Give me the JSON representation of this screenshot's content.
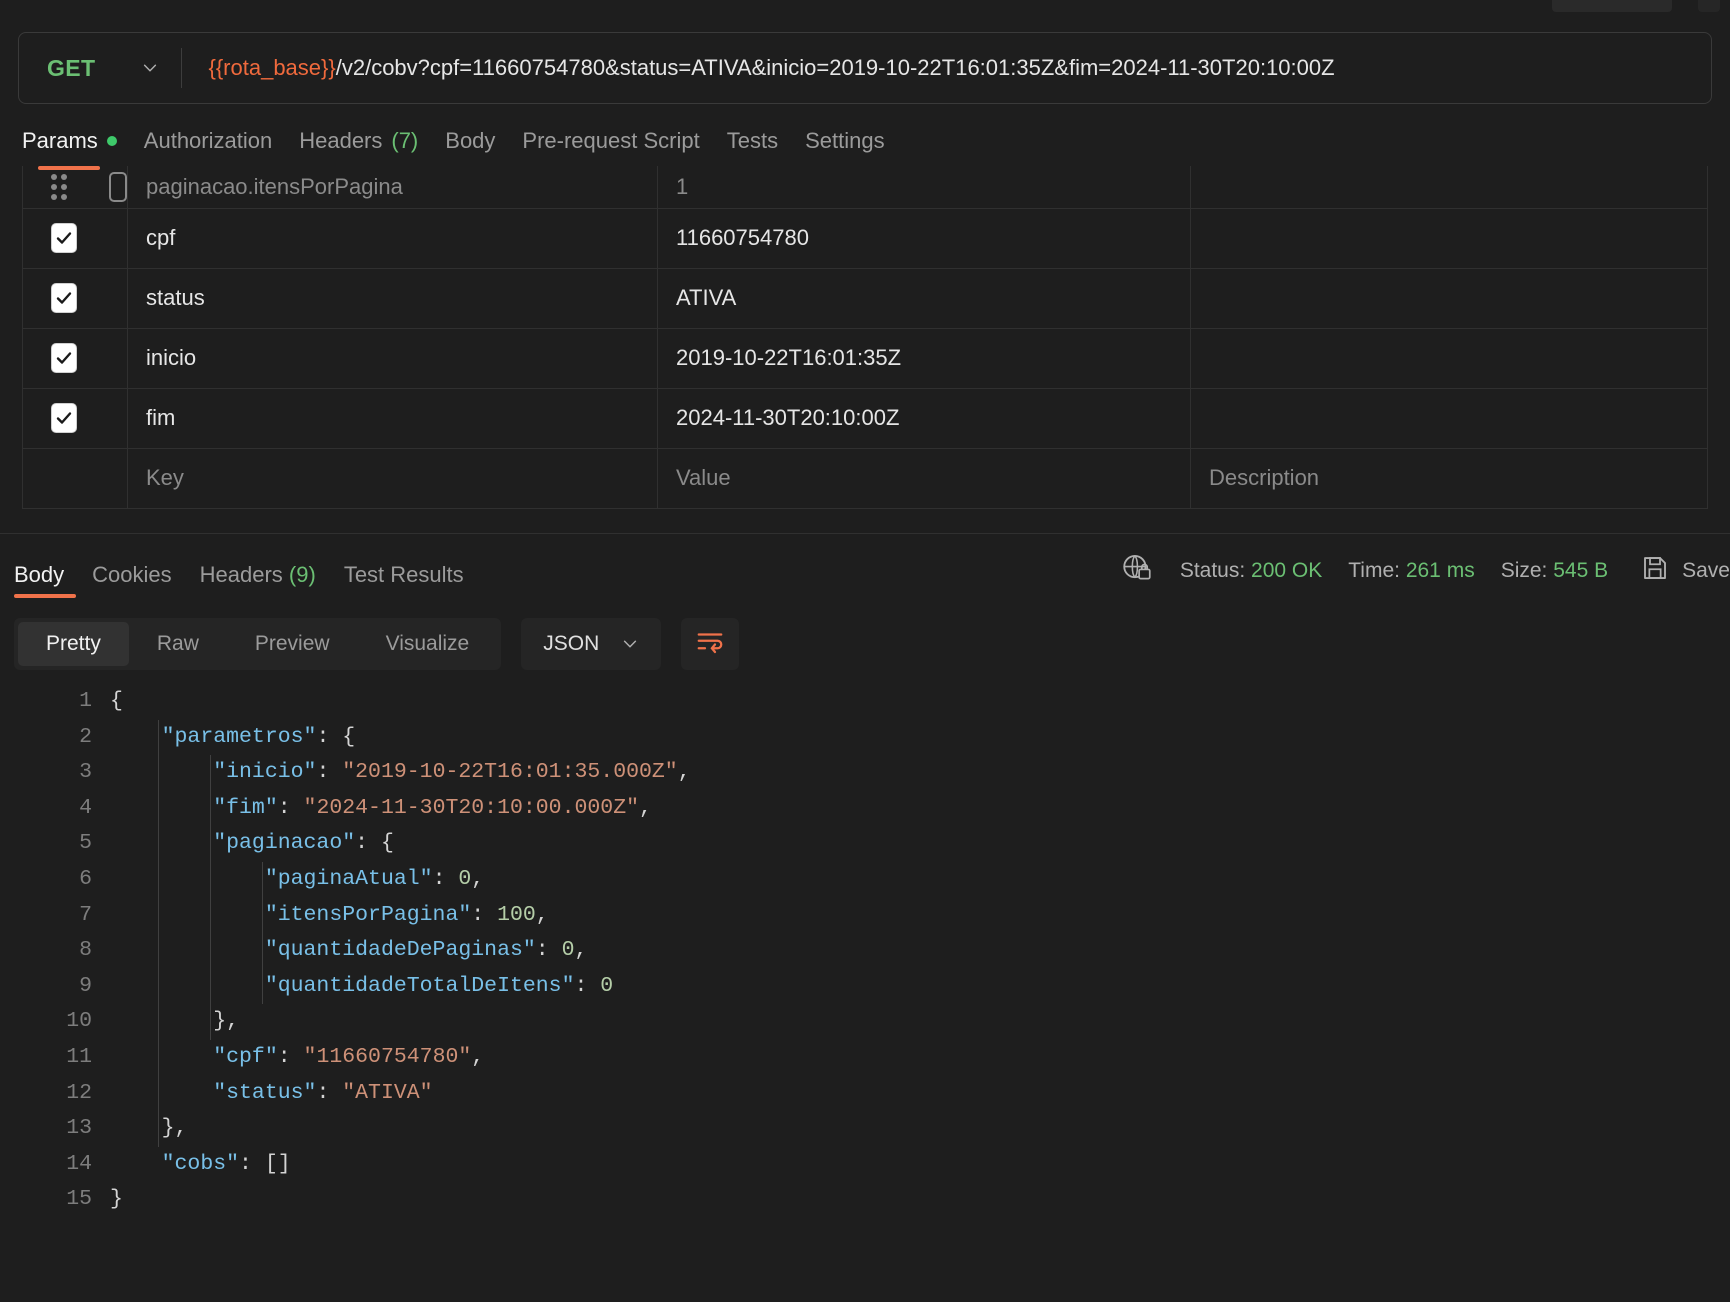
{
  "request": {
    "method": "GET",
    "url_prefix": "{{rota_base}}",
    "url_rest": "/v2/cobv?cpf=11660754780&status=ATIVA&inicio=2019-10-22T16:01:35Z&fim=2024-11-30T20:10:00Z",
    "tabs": [
      {
        "label": "Params",
        "badge": "",
        "dot": true,
        "active": true
      },
      {
        "label": "Authorization",
        "badge": "",
        "dot": false,
        "active": false
      },
      {
        "label": "Headers",
        "badge": "(7)",
        "dot": false,
        "active": false
      },
      {
        "label": "Body",
        "badge": "",
        "dot": false,
        "active": false
      },
      {
        "label": "Pre-request Script",
        "badge": "",
        "dot": false,
        "active": false
      },
      {
        "label": "Tests",
        "badge": "",
        "dot": false,
        "active": false
      },
      {
        "label": "Settings",
        "badge": "",
        "dot": false,
        "active": false
      }
    ]
  },
  "params_table": {
    "columns": [
      "Key",
      "Value",
      "Description"
    ],
    "rows": [
      {
        "checked": false,
        "key": "paginacao.itensPorPagina",
        "value": "1",
        "description": "",
        "ghost": true
      },
      {
        "checked": true,
        "key": "cpf",
        "value": "11660754780",
        "description": "",
        "ghost": false
      },
      {
        "checked": true,
        "key": "status",
        "value": "ATIVA",
        "description": "",
        "ghost": false
      },
      {
        "checked": true,
        "key": "inicio",
        "value": "2019-10-22T16:01:35Z",
        "description": "",
        "ghost": false
      },
      {
        "checked": true,
        "key": "fim",
        "value": "2024-11-30T20:10:00Z",
        "description": "",
        "ghost": false
      }
    ],
    "placeholder_row": {
      "key": "Key",
      "value": "Value",
      "description": "Description"
    }
  },
  "response": {
    "tabs": [
      {
        "label": "Body",
        "badge": "",
        "active": true
      },
      {
        "label": "Cookies",
        "badge": "",
        "active": false
      },
      {
        "label": "Headers",
        "badge": "(9)",
        "active": false
      },
      {
        "label": "Test Results",
        "badge": "",
        "active": false
      }
    ],
    "meta": {
      "status_label": "Status:",
      "status_value": "200 OK",
      "time_label": "Time:",
      "time_value": "261 ms",
      "size_label": "Size:",
      "size_value": "545 B",
      "save_label": "Save"
    },
    "toolbar": {
      "views": [
        "Pretty",
        "Raw",
        "Preview",
        "Visualize"
      ],
      "active_view": "Pretty",
      "format": "JSON"
    },
    "body_lines": [
      {
        "n": "1",
        "tokens": [
          {
            "t": "{",
            "c": "p"
          }
        ],
        "indent": 0
      },
      {
        "n": "2",
        "tokens": [
          {
            "t": "\"parametros\"",
            "c": "k"
          },
          {
            "t": ": {",
            "c": "p"
          }
        ],
        "indent": 1
      },
      {
        "n": "3",
        "tokens": [
          {
            "t": "\"inicio\"",
            "c": "k"
          },
          {
            "t": ": ",
            "c": "p"
          },
          {
            "t": "\"2019-10-22T16:01:35.000Z\"",
            "c": "s"
          },
          {
            "t": ",",
            "c": "p"
          }
        ],
        "indent": 2
      },
      {
        "n": "4",
        "tokens": [
          {
            "t": "\"fim\"",
            "c": "k"
          },
          {
            "t": ": ",
            "c": "p"
          },
          {
            "t": "\"2024-11-30T20:10:00.000Z\"",
            "c": "s"
          },
          {
            "t": ",",
            "c": "p"
          }
        ],
        "indent": 2
      },
      {
        "n": "5",
        "tokens": [
          {
            "t": "\"paginacao\"",
            "c": "k"
          },
          {
            "t": ": {",
            "c": "p"
          }
        ],
        "indent": 2
      },
      {
        "n": "6",
        "tokens": [
          {
            "t": "\"paginaAtual\"",
            "c": "k"
          },
          {
            "t": ": ",
            "c": "p"
          },
          {
            "t": "0",
            "c": "n"
          },
          {
            "t": ",",
            "c": "p"
          }
        ],
        "indent": 3
      },
      {
        "n": "7",
        "tokens": [
          {
            "t": "\"itensPorPagina\"",
            "c": "k"
          },
          {
            "t": ": ",
            "c": "p"
          },
          {
            "t": "100",
            "c": "n"
          },
          {
            "t": ",",
            "c": "p"
          }
        ],
        "indent": 3
      },
      {
        "n": "8",
        "tokens": [
          {
            "t": "\"quantidadeDePaginas\"",
            "c": "k"
          },
          {
            "t": ": ",
            "c": "p"
          },
          {
            "t": "0",
            "c": "n"
          },
          {
            "t": ",",
            "c": "p"
          }
        ],
        "indent": 3
      },
      {
        "n": "9",
        "tokens": [
          {
            "t": "\"quantidadeTotalDeItens\"",
            "c": "k"
          },
          {
            "t": ": ",
            "c": "p"
          },
          {
            "t": "0",
            "c": "n"
          }
        ],
        "indent": 3
      },
      {
        "n": "10",
        "tokens": [
          {
            "t": "},",
            "c": "p"
          }
        ],
        "indent": 2
      },
      {
        "n": "11",
        "tokens": [
          {
            "t": "\"cpf\"",
            "c": "k"
          },
          {
            "t": ": ",
            "c": "p"
          },
          {
            "t": "\"11660754780\"",
            "c": "s"
          },
          {
            "t": ",",
            "c": "p"
          }
        ],
        "indent": 2
      },
      {
        "n": "12",
        "tokens": [
          {
            "t": "\"status\"",
            "c": "k"
          },
          {
            "t": ": ",
            "c": "p"
          },
          {
            "t": "\"ATIVA\"",
            "c": "s"
          }
        ],
        "indent": 2
      },
      {
        "n": "13",
        "tokens": [
          {
            "t": "},",
            "c": "p"
          }
        ],
        "indent": 1
      },
      {
        "n": "14",
        "tokens": [
          {
            "t": "\"cobs\"",
            "c": "k"
          },
          {
            "t": ": []",
            "c": "p"
          }
        ],
        "indent": 1
      },
      {
        "n": "15",
        "tokens": [
          {
            "t": "}",
            "c": "p"
          }
        ],
        "indent": 0
      }
    ]
  },
  "colors": {
    "accent": "#f0724a",
    "success": "#6bbf73",
    "background": "#1e1e1e",
    "json_key": "#79c0e8",
    "json_string": "#ce9178",
    "json_number": "#b5cea8"
  }
}
